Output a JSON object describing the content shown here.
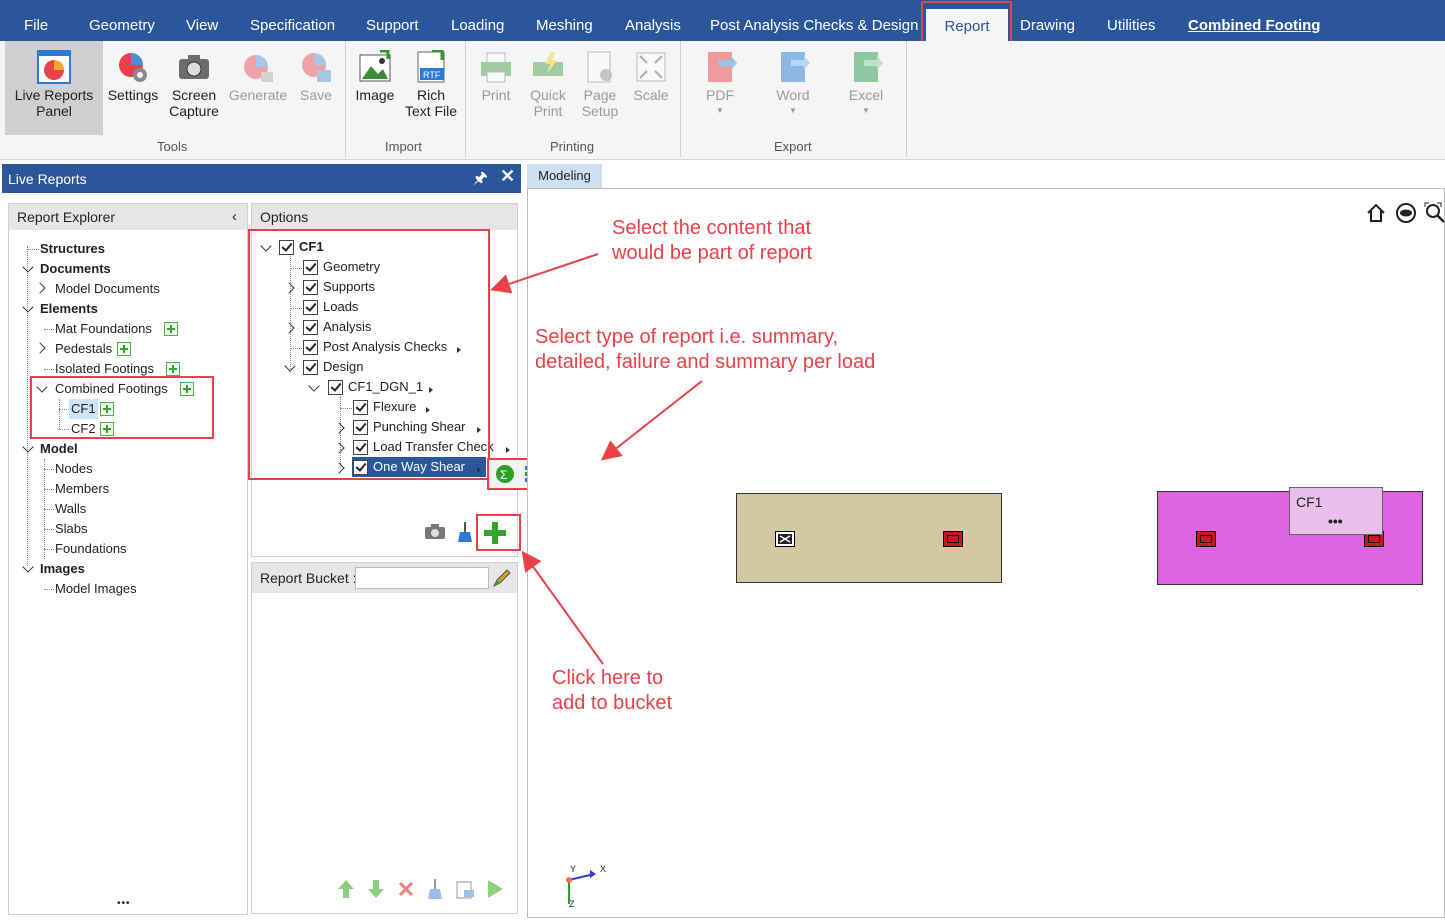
{
  "menu": {
    "items": [
      "File",
      "Geometry",
      "View",
      "Specification",
      "Support",
      "Loading",
      "Meshing",
      "Analysis",
      "Post Analysis Checks & Design",
      "Report",
      "Drawing",
      "Utilities",
      "Combined Footing"
    ],
    "active": "Report"
  },
  "ribbon": {
    "tools": {
      "group": "Tools",
      "live_reports": "Live Reports Panel",
      "settings": "Settings",
      "screen_capture": "Screen Capture",
      "generate": "Generate",
      "save": "Save"
    },
    "import": {
      "group": "Import",
      "image": "Image",
      "rich_text": "Rich Text File",
      "rtf_badge": "RTF"
    },
    "printing": {
      "group": "Printing",
      "print": "Print",
      "quick_print": "Quick Print",
      "page_setup": "Page Setup",
      "scale": "Scale"
    },
    "export": {
      "group": "Export",
      "pdf": "PDF",
      "word": "Word",
      "excel": "Excel"
    }
  },
  "live_reports": {
    "title": "Live Reports",
    "explorer": {
      "header": "Report Explorer",
      "items": {
        "structures": "Structures",
        "documents": "Documents",
        "model_documents": "Model Documents",
        "elements": "Elements",
        "mat_foundations": "Mat Foundations",
        "pedestals": "Pedestals",
        "isolated_footings": "Isolated Footings",
        "combined_footings": "Combined Footings",
        "cf1": "CF1",
        "cf2": "CF2",
        "model": "Model",
        "nodes": "Nodes",
        "members": "Members",
        "walls": "Walls",
        "slabs": "Slabs",
        "foundations": "Foundations",
        "images": "Images",
        "model_images": "Model Images"
      }
    },
    "options": {
      "header": "Options",
      "items": {
        "cf1": "CF1",
        "geometry": "Geometry",
        "supports": "Supports",
        "loads": "Loads",
        "analysis": "Analysis",
        "post_analysis": "Post Analysis Checks",
        "design": "Design",
        "cf1_dgn": "CF1_DGN_1",
        "flexure": "Flexure",
        "punching": "Punching Shear",
        "load_transfer": "Load Transfer Check",
        "one_way": "One Way Shear"
      }
    },
    "bucket": {
      "label": "Report Bucket :",
      "value": ""
    }
  },
  "modeling": {
    "tab": "Modeling",
    "footing_label": "CF1",
    "axis_x": "X",
    "axis_y": "Y",
    "axis_z": "Z"
  },
  "annotations": {
    "a1_line1": "Select the content that",
    "a1_line2": "would be part of report",
    "a2_line1": "Select type of report i.e. summary,",
    "a2_line2": "detailed, failure and summary per load",
    "a3_line1": "Click here to",
    "a3_line2": "add to bucket"
  },
  "colors": {
    "accent": "#2b579a",
    "annotation": "#e8414a",
    "footing_tan": "#d2c8a3",
    "footing_magenta": "#de63de"
  }
}
